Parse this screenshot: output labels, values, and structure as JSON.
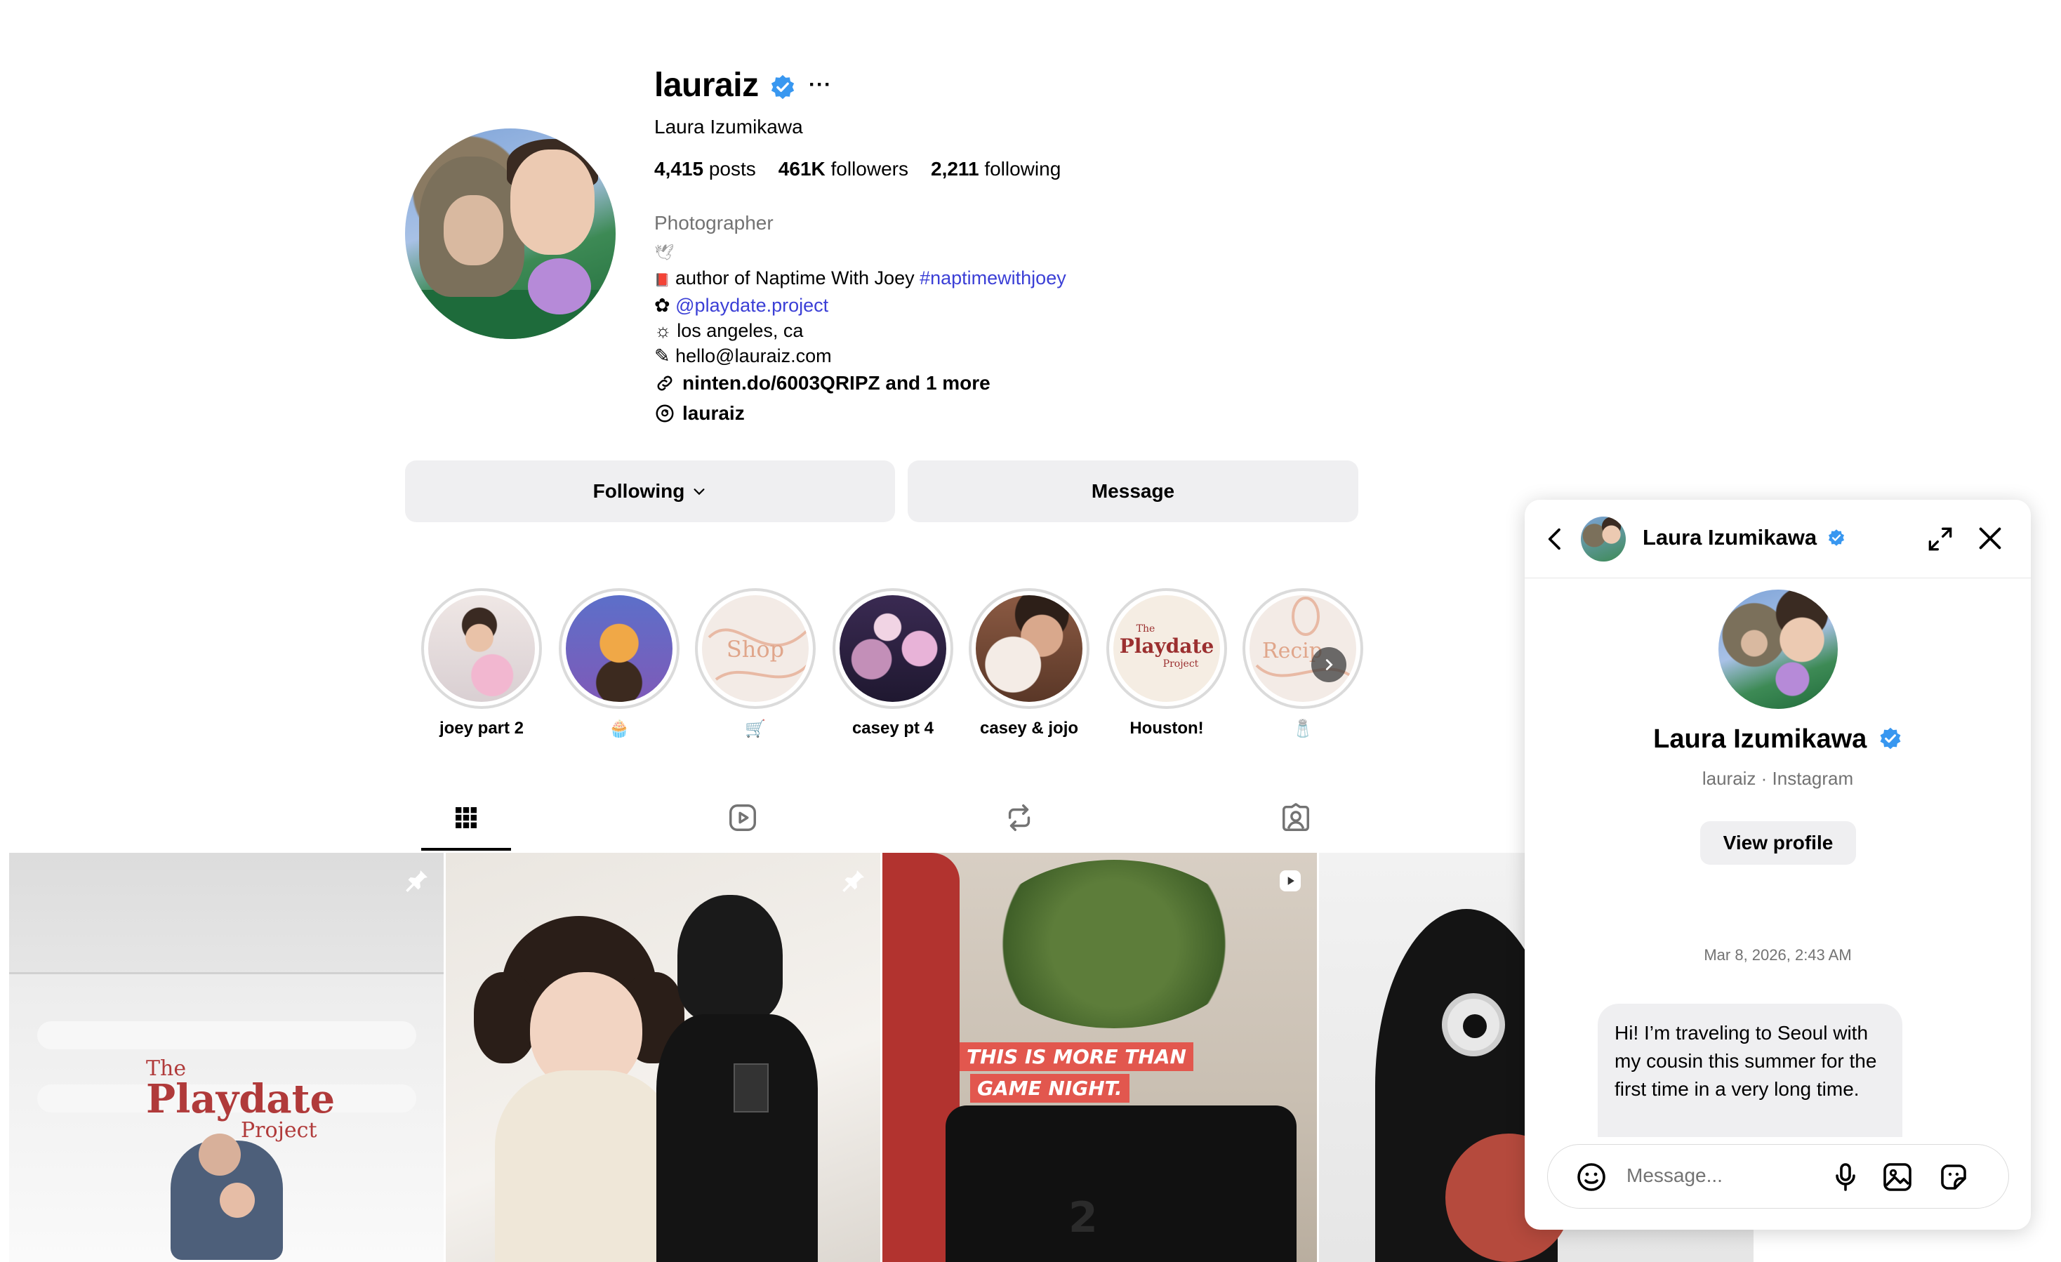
{
  "profile": {
    "username": "lauraiz",
    "full_name": "Laura Izumikawa",
    "more_label": "···",
    "stats": {
      "posts_count": "4,415",
      "posts_label": "posts",
      "followers_count": "461K",
      "followers_label": "followers",
      "following_count": "2,211",
      "following_label": "following"
    },
    "category": "Photographer",
    "bio_lines": [
      {
        "icon": "🕊",
        "text": ""
      },
      {
        "icon": "📕",
        "text": "author of Naptime With Joey ",
        "hashtag": "#naptimewithjoey"
      },
      {
        "icon": "✿",
        "mention": "@playdate.project"
      },
      {
        "icon": "☼",
        "text": "los angeles, ca"
      },
      {
        "icon": "✎",
        "text": "hello@lauraiz.com"
      }
    ],
    "link": {
      "icon": "link-icon",
      "text": "ninten.do/6003QRIPZ and 1 more"
    },
    "threads": {
      "icon": "threads-icon",
      "text": "lauraiz"
    },
    "buttons": {
      "following": "Following",
      "message": "Message"
    }
  },
  "highlights": [
    {
      "label": "joey part 2"
    },
    {
      "label": "🧁"
    },
    {
      "label": "🛒"
    },
    {
      "label": "casey pt 4"
    },
    {
      "label": "casey & jojo"
    },
    {
      "label": "Houston!"
    },
    {
      "label": "🧂"
    }
  ],
  "highlight_art": {
    "shop": "Shop",
    "playdate_the": "The",
    "playdate_title": "Playdate",
    "playdate_project": "Project",
    "recipes": "Recip"
  },
  "tabs": [
    {
      "name": "posts",
      "icon": "grid-icon",
      "active": true
    },
    {
      "name": "reels",
      "icon": "reels-icon",
      "active": false
    },
    {
      "name": "reposts",
      "icon": "repost-icon",
      "active": false
    },
    {
      "name": "tagged",
      "icon": "tagged-icon",
      "active": false
    }
  ],
  "grid": {
    "tile1_text": {
      "the": "The",
      "title": "Playdate",
      "project": "Project"
    },
    "tile3_text": {
      "line1": "THIS IS MORE THAN",
      "line2": "GAME NIGHT."
    },
    "tile3_console": "2"
  },
  "dm": {
    "title": "Laura Izumikawa",
    "name": "Laura Izumikawa",
    "subtitle": "lauraiz · Instagram",
    "view_profile": "View profile",
    "date": "Mar 8, 2026, 2:43 AM",
    "message": "Hi! I’m traveling to Seoul with my cousin this summer for the first time in a very long time.",
    "input_placeholder": "Message..."
  },
  "colors": {
    "verified": "#3897f0",
    "link": "#3b3fd6",
    "button_bg": "#efeff1"
  }
}
